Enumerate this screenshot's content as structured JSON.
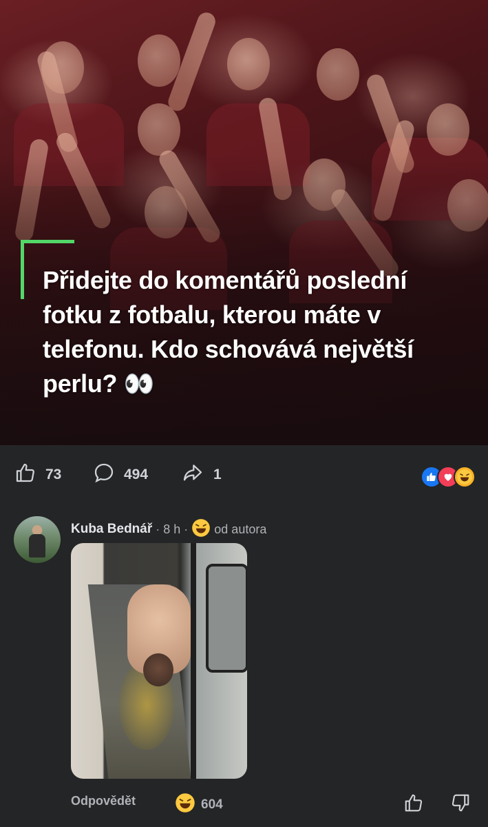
{
  "post": {
    "caption": "Přidejte do komentářů poslední fotku z fotbalu, kterou máte v telefonu. Kdo schovává největší perlu? 👀"
  },
  "stats": {
    "likes": "73",
    "comments": "494",
    "shares": "1",
    "reactions": [
      "like",
      "love",
      "haha"
    ]
  },
  "comment": {
    "author": "Kuba Bednář",
    "separator": "·",
    "time": "8 h",
    "author_label": "od autora",
    "reply_label": "Odpovědět",
    "reaction_count": "604"
  },
  "colors": {
    "background": "#242526",
    "accent_green": "#53d769",
    "like_blue": "#1877f2",
    "love_red": "#f33e58",
    "haha_yellow": "#f7b125"
  }
}
